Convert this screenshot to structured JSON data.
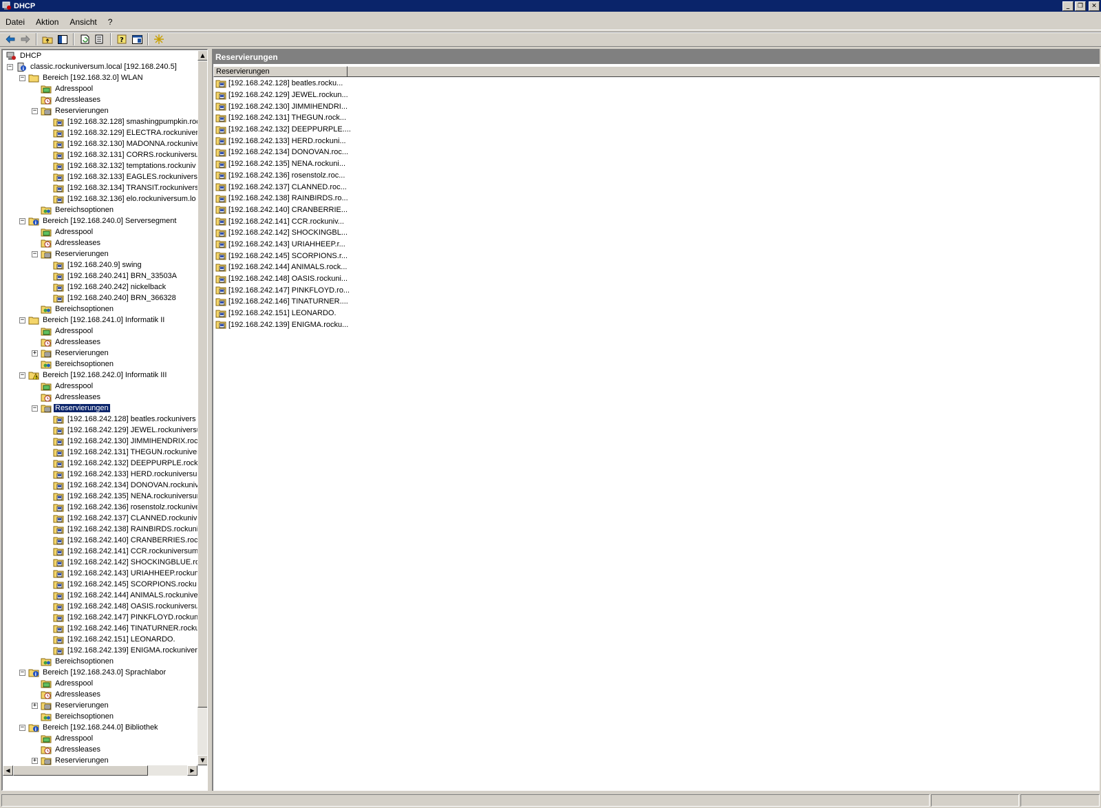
{
  "window": {
    "title": "DHCP"
  },
  "menubar": {
    "items": [
      "Datei",
      "Aktion",
      "Ansicht",
      "?"
    ]
  },
  "tree": {
    "nodes": [
      {
        "level": 0,
        "label": "DHCP",
        "icon": "dhcp",
        "toggle": ""
      },
      {
        "level": 0,
        "label": "classic.rockuniversum.local [192.168.240.5]",
        "icon": "server",
        "toggle": "-"
      },
      {
        "level": 1,
        "label": "Bereich [192.168.32.0] WLAN",
        "icon": "folder",
        "toggle": "-"
      },
      {
        "level": 2,
        "label": "Adresspool",
        "icon": "pool",
        "toggle": ""
      },
      {
        "level": 2,
        "label": "Adressleases",
        "icon": "lease",
        "toggle": ""
      },
      {
        "level": 2,
        "label": "Reservierungen",
        "icon": "reservations",
        "toggle": "-"
      },
      {
        "level": 3,
        "label": "[192.168.32.128] smashingpumpkin.roc",
        "icon": "res",
        "toggle": ""
      },
      {
        "level": 3,
        "label": "[192.168.32.129] ELECTRA.rockunivers",
        "icon": "res",
        "toggle": ""
      },
      {
        "level": 3,
        "label": "[192.168.32.130] MADONNA.rockunive",
        "icon": "res",
        "toggle": ""
      },
      {
        "level": 3,
        "label": "[192.168.32.131] CORRS.rockuniversu",
        "icon": "res",
        "toggle": ""
      },
      {
        "level": 3,
        "label": "[192.168.32.132] temptations.rockuniv",
        "icon": "res",
        "toggle": ""
      },
      {
        "level": 3,
        "label": "[192.168.32.133] EAGLES.rockunivers",
        "icon": "res",
        "toggle": ""
      },
      {
        "level": 3,
        "label": "[192.168.32.134] TRANSIT.rockunivers",
        "icon": "res",
        "toggle": ""
      },
      {
        "level": 3,
        "label": "[192.168.32.136] elo.rockuniversum.lo",
        "icon": "res",
        "toggle": ""
      },
      {
        "level": 2,
        "label": "Bereichsoptionen",
        "icon": "options",
        "toggle": ""
      },
      {
        "level": 1,
        "label": "Bereich [192.168.240.0] Serversegment",
        "icon": "scope-info",
        "toggle": "-"
      },
      {
        "level": 2,
        "label": "Adresspool",
        "icon": "pool",
        "toggle": ""
      },
      {
        "level": 2,
        "label": "Adressleases",
        "icon": "lease",
        "toggle": ""
      },
      {
        "level": 2,
        "label": "Reservierungen",
        "icon": "reservations",
        "toggle": "-"
      },
      {
        "level": 3,
        "label": "[192.168.240.9] swing",
        "icon": "res",
        "toggle": ""
      },
      {
        "level": 3,
        "label": "[192.168.240.241] BRN_33503A",
        "icon": "res",
        "toggle": ""
      },
      {
        "level": 3,
        "label": "[192.168.240.242] nickelback",
        "icon": "res",
        "toggle": ""
      },
      {
        "level": 3,
        "label": "[192.168.240.240] BRN_366328",
        "icon": "res",
        "toggle": ""
      },
      {
        "level": 2,
        "label": "Bereichsoptionen",
        "icon": "options",
        "toggle": ""
      },
      {
        "level": 1,
        "label": "Bereich [192.168.241.0] Informatik II",
        "icon": "folder",
        "toggle": "-"
      },
      {
        "level": 2,
        "label": "Adresspool",
        "icon": "pool",
        "toggle": ""
      },
      {
        "level": 2,
        "label": "Adressleases",
        "icon": "lease",
        "toggle": ""
      },
      {
        "level": 2,
        "label": "Reservierungen",
        "icon": "reservations",
        "toggle": "+"
      },
      {
        "level": 2,
        "label": "Bereichsoptionen",
        "icon": "options",
        "toggle": ""
      },
      {
        "level": 1,
        "label": "Bereich [192.168.242.0] Informatik III",
        "icon": "scope-warn",
        "toggle": "-"
      },
      {
        "level": 2,
        "label": "Adresspool",
        "icon": "pool",
        "toggle": ""
      },
      {
        "level": 2,
        "label": "Adressleases",
        "icon": "lease",
        "toggle": ""
      },
      {
        "level": 2,
        "label": "Reservierungen",
        "icon": "reservations",
        "toggle": "-",
        "selected": true
      },
      {
        "level": 3,
        "label": "[192.168.242.128] beatles.rockunivers",
        "icon": "res",
        "toggle": ""
      },
      {
        "level": 3,
        "label": "[192.168.242.129] JEWEL.rockuniversu",
        "icon": "res",
        "toggle": ""
      },
      {
        "level": 3,
        "label": "[192.168.242.130] JIMMIHENDRIX.rock",
        "icon": "res",
        "toggle": ""
      },
      {
        "level": 3,
        "label": "[192.168.242.131] THEGUN.rockuniver",
        "icon": "res",
        "toggle": ""
      },
      {
        "level": 3,
        "label": "[192.168.242.132] DEEPPURPLE.rocku",
        "icon": "res",
        "toggle": ""
      },
      {
        "level": 3,
        "label": "[192.168.242.133] HERD.rockuniversur",
        "icon": "res",
        "toggle": ""
      },
      {
        "level": 3,
        "label": "[192.168.242.134] DONOVAN.rockunive",
        "icon": "res",
        "toggle": ""
      },
      {
        "level": 3,
        "label": "[192.168.242.135] NENA.rockuniversur",
        "icon": "res",
        "toggle": ""
      },
      {
        "level": 3,
        "label": "[192.168.242.136] rosenstolz.rockunive",
        "icon": "res",
        "toggle": ""
      },
      {
        "level": 3,
        "label": "[192.168.242.137] CLANNED.rockunive",
        "icon": "res",
        "toggle": ""
      },
      {
        "level": 3,
        "label": "[192.168.242.138] RAINBIRDS.rockuni",
        "icon": "res",
        "toggle": ""
      },
      {
        "level": 3,
        "label": "[192.168.242.140] CRANBERRIES.rock",
        "icon": "res",
        "toggle": ""
      },
      {
        "level": 3,
        "label": "[192.168.242.141] CCR.rockuniversum",
        "icon": "res",
        "toggle": ""
      },
      {
        "level": 3,
        "label": "[192.168.242.142] SHOCKINGBLUE.roc",
        "icon": "res",
        "toggle": ""
      },
      {
        "level": 3,
        "label": "[192.168.242.143] URIAHHEEP.rockuni",
        "icon": "res",
        "toggle": ""
      },
      {
        "level": 3,
        "label": "[192.168.242.145] SCORPIONS.rocku",
        "icon": "res",
        "toggle": ""
      },
      {
        "level": 3,
        "label": "[192.168.242.144] ANIMALS.rockunive",
        "icon": "res",
        "toggle": ""
      },
      {
        "level": 3,
        "label": "[192.168.242.148] OASIS.rockuniversu",
        "icon": "res",
        "toggle": ""
      },
      {
        "level": 3,
        "label": "[192.168.242.147] PINKFLOYD.rockuni",
        "icon": "res",
        "toggle": ""
      },
      {
        "level": 3,
        "label": "[192.168.242.146] TINATURNER.rocku",
        "icon": "res",
        "toggle": ""
      },
      {
        "level": 3,
        "label": "[192.168.242.151] LEONARDO.",
        "icon": "res",
        "toggle": ""
      },
      {
        "level": 3,
        "label": "[192.168.242.139] ENIGMA.rockunivers",
        "icon": "res",
        "toggle": ""
      },
      {
        "level": 2,
        "label": "Bereichsoptionen",
        "icon": "options",
        "toggle": ""
      },
      {
        "level": 1,
        "label": "Bereich [192.168.243.0] Sprachlabor",
        "icon": "scope-info",
        "toggle": "-"
      },
      {
        "level": 2,
        "label": "Adresspool",
        "icon": "pool",
        "toggle": ""
      },
      {
        "level": 2,
        "label": "Adressleases",
        "icon": "lease",
        "toggle": ""
      },
      {
        "level": 2,
        "label": "Reservierungen",
        "icon": "reservations",
        "toggle": "+"
      },
      {
        "level": 2,
        "label": "Bereichsoptionen",
        "icon": "options",
        "toggle": ""
      },
      {
        "level": 1,
        "label": "Bereich [192.168.244.0] Bibliothek",
        "icon": "scope-info",
        "toggle": "-"
      },
      {
        "level": 2,
        "label": "Adresspool",
        "icon": "pool",
        "toggle": ""
      },
      {
        "level": 2,
        "label": "Adressleases",
        "icon": "lease",
        "toggle": ""
      },
      {
        "level": 2,
        "label": "Reservierungen",
        "icon": "reservations",
        "toggle": "+"
      },
      {
        "level": 2,
        "label": "Bereichsoptionen",
        "icon": "options",
        "toggle": ""
      }
    ]
  },
  "details": {
    "header": "Reservierungen",
    "column": "Reservierungen",
    "items": [
      "[192.168.242.128] beatles.rocku...",
      "[192.168.242.129] JEWEL.rockun...",
      "[192.168.242.130] JIMMIHENDRI...",
      "[192.168.242.131] THEGUN.rock...",
      "[192.168.242.132] DEEPPURPLE....",
      "[192.168.242.133] HERD.rockuni...",
      "[192.168.242.134] DONOVAN.roc...",
      "[192.168.242.135] NENA.rockuni...",
      "[192.168.242.136] rosenstolz.roc...",
      "[192.168.242.137] CLANNED.roc...",
      "[192.168.242.138] RAINBIRDS.ro...",
      "[192.168.242.140] CRANBERRIE...",
      "[192.168.242.141] CCR.rockuniv...",
      "[192.168.242.142] SHOCKINGBL...",
      "[192.168.242.143] URIAHHEEP.r...",
      "[192.168.242.145] SCORPIONS.r...",
      "[192.168.242.144] ANIMALS.rock...",
      "[192.168.242.148] OASIS.rockuni...",
      "[192.168.242.147] PINKFLOYD.ro...",
      "[192.168.242.146] TINATURNER....",
      "[192.168.242.151] LEONARDO.",
      "[192.168.242.139] ENIGMA.rocku..."
    ]
  }
}
